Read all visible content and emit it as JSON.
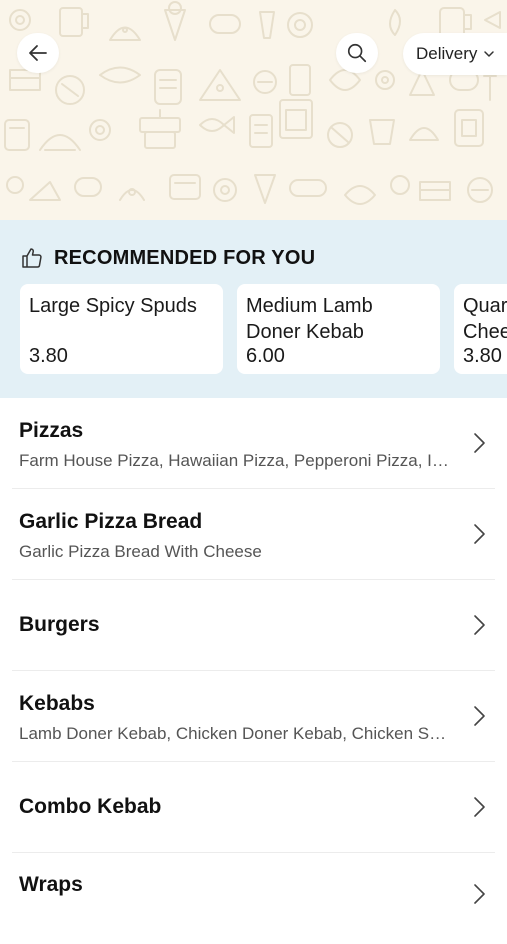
{
  "header": {
    "delivery_label": "Delivery",
    "icons": [
      "back-arrow-icon",
      "search-icon",
      "chevron-down-icon"
    ]
  },
  "recommended": {
    "title": "RECOMMENDED FOR YOU",
    "items": [
      {
        "name_line1": "Large Spicy Spuds",
        "name_line2": "",
        "price": "3.80"
      },
      {
        "name_line1": "Medium Lamb",
        "name_line2": "Doner Kebab",
        "price": "6.00"
      },
      {
        "name_line1": "Quar",
        "name_line2": "Chee",
        "price": "3.80"
      }
    ]
  },
  "categories": [
    {
      "title": "Pizzas",
      "subtitle": "Farm House Pizza, Hawaiian Pizza, Pepperoni Pizza, It…"
    },
    {
      "title": "Garlic Pizza Bread",
      "subtitle": "Garlic Pizza Bread With Cheese"
    },
    {
      "title": "Burgers",
      "subtitle": ""
    },
    {
      "title": "Kebabs",
      "subtitle": "Lamb Doner Kebab, Chicken Doner Kebab, Chicken Sh…"
    },
    {
      "title": "Combo Kebab",
      "subtitle": ""
    },
    {
      "title": "Wraps",
      "subtitle": ""
    }
  ],
  "colors": {
    "header_bg": "#faf5ea",
    "pattern_stroke": "#e7dfcc",
    "recommended_bg": "#e3f0f6"
  }
}
